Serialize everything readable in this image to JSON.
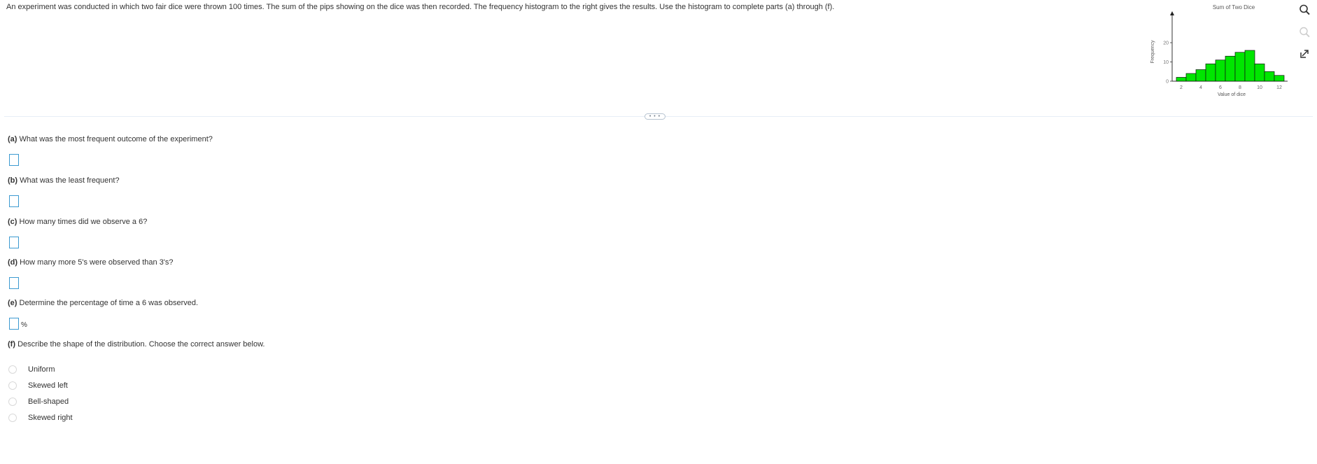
{
  "intro": "An experiment was conducted in which two fair dice were thrown 100 times. The sum of the pips showing on the dice was then recorded. The frequency histogram to the right gives the results. Use the histogram to complete parts (a) through (f).",
  "more_button": "• • •",
  "questions": [
    {
      "letter": "(a)",
      "text": "What was the most frequent outcome of the experiment?"
    },
    {
      "letter": "(b)",
      "text": "What was the least frequent?"
    },
    {
      "letter": "(c)",
      "text": "How many times did we observe a 6?"
    },
    {
      "letter": "(d)",
      "text": "How many more 5's were observed than 3's?"
    },
    {
      "letter": "(e)",
      "text": "Determine the percentage of time a 6 was observed."
    },
    {
      "letter": "(f)",
      "text": "Describe the shape of the distribution. Choose the correct answer below."
    }
  ],
  "answers": [
    "",
    "",
    "",
    "",
    ""
  ],
  "percent_symbol": "%",
  "options": [
    "Uniform",
    "Skewed left",
    "Bell-shaped",
    "Skewed right"
  ],
  "icons": {
    "zoom": "zoom-in-icon",
    "zoom_out": "zoom-out-icon",
    "popout": "popout-icon"
  },
  "chart_data": {
    "type": "bar",
    "title": "Sum of Two Dice",
    "xlabel": "Value of dice",
    "ylabel": "Frequency",
    "categories": [
      2,
      3,
      4,
      5,
      6,
      7,
      8,
      9,
      10,
      11,
      12
    ],
    "values": [
      2,
      4,
      6,
      9,
      11,
      13,
      15,
      16,
      9,
      5,
      3
    ],
    "xticks": [
      "2",
      "4",
      "6",
      "8",
      "10",
      "12"
    ],
    "yticks": [
      "0",
      "10",
      "20"
    ],
    "ylim": [
      0,
      20
    ],
    "bar_color": "#00e600",
    "grid": false
  }
}
